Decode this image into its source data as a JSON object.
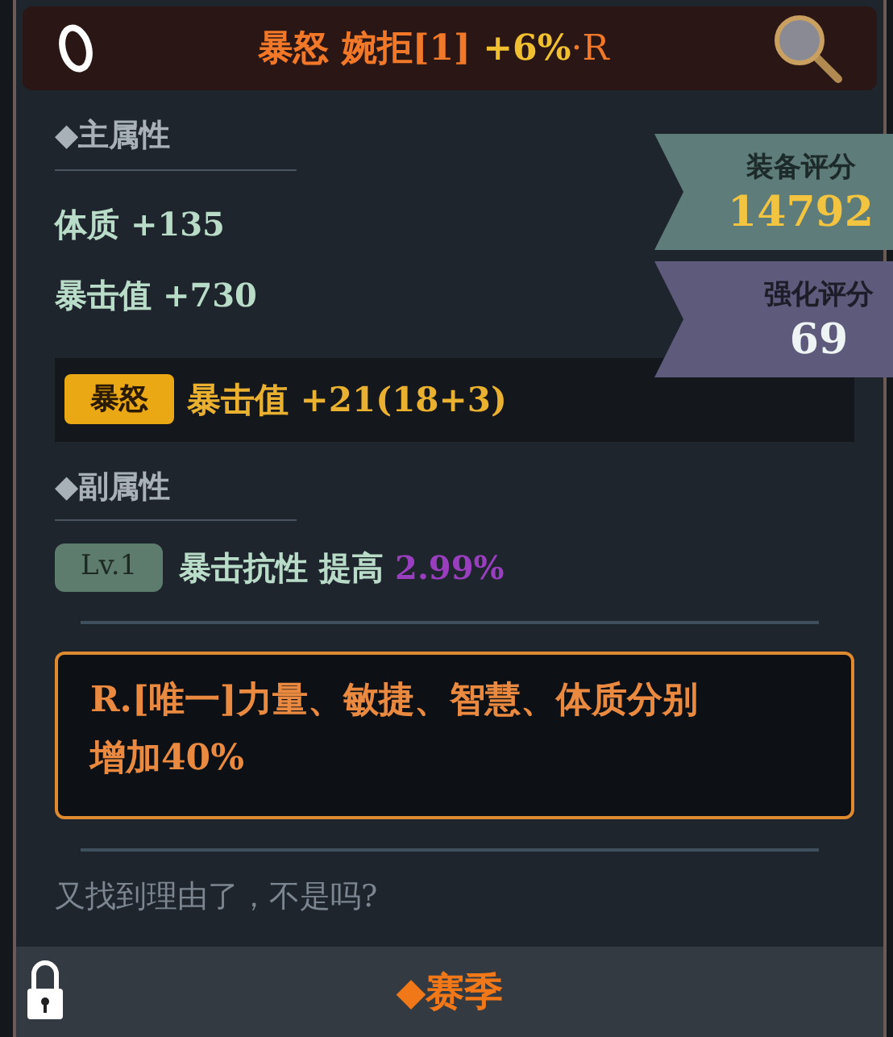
{
  "header": {
    "name": "暴怒 婉拒[1]",
    "bonus": "+6%",
    "suffix": "·R"
  },
  "scores": [
    {
      "label": "装备评分",
      "value": "14792",
      "kind": "equip"
    },
    {
      "label": "强化评分",
      "value": "69",
      "kind": "enhance"
    }
  ],
  "main_attributes": {
    "heading": "◆主属性",
    "stats": [
      "体质 +135",
      "暴击值 +730"
    ]
  },
  "set_bonus": {
    "tag": "暴怒",
    "text": "暴击值 +21(18+3)"
  },
  "sub_attributes": {
    "heading": "◆副属性",
    "stats": [
      {
        "level": "Lv.1",
        "text": "暴击抗性 提高",
        "value": "2.99%"
      }
    ]
  },
  "unique_effect": "R.[唯一]力量、敏捷、智慧、体质分别增加40%",
  "flavor_text": "又找到理由了，不是吗?",
  "footer": {
    "locked": true,
    "label": "◆赛季"
  }
}
